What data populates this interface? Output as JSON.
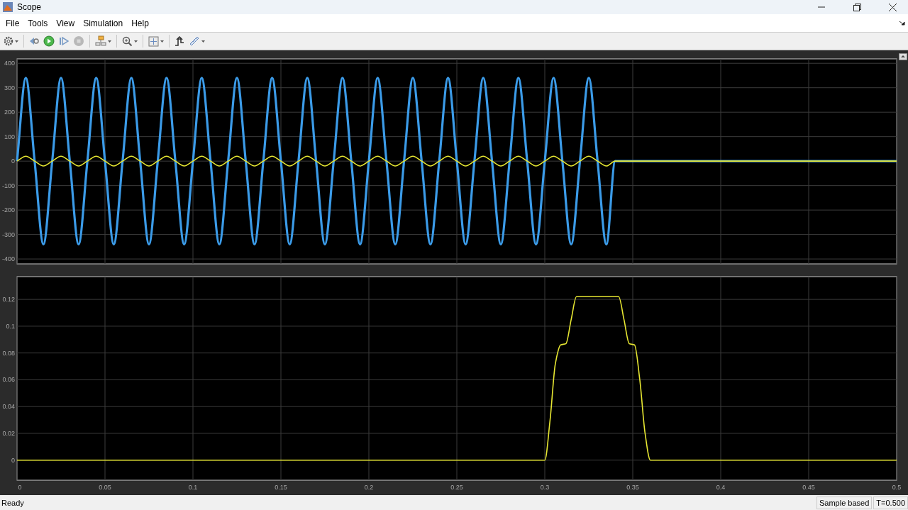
{
  "window": {
    "title": "Scope"
  },
  "menu": [
    "File",
    "Tools",
    "View",
    "Simulation",
    "Help"
  ],
  "charts": [
    {
      "chart_data": {
        "type": "line",
        "grid": true,
        "xlim": [
          0,
          0.5
        ],
        "ylim": [
          -420,
          418
        ],
        "yticks": [
          -400,
          -300,
          -200,
          -100,
          0,
          100,
          200,
          300,
          400
        ],
        "x": [
          0,
          0.005,
          0.01,
          0.015,
          0.02,
          0.025,
          0.03,
          0.035,
          0.04,
          0.045,
          0.05,
          0.055,
          0.06,
          0.065,
          0.07,
          0.075,
          0.08,
          0.085,
          0.09,
          0.095,
          0.1,
          0.105,
          0.11,
          0.115,
          0.12,
          0.125,
          0.13,
          0.135,
          0.14,
          0.145,
          0.15,
          0.155,
          0.16,
          0.165,
          0.17,
          0.175,
          0.18,
          0.185,
          0.19,
          0.195,
          0.2,
          0.205,
          0.21,
          0.215,
          0.22,
          0.225,
          0.23,
          0.235,
          0.24,
          0.245,
          0.25,
          0.255,
          0.26,
          0.265,
          0.27,
          0.275,
          0.28,
          0.285,
          0.29,
          0.295,
          0.3,
          0.305,
          0.31,
          0.315,
          0.32,
          0.325,
          0.33,
          0.335,
          0.34,
          0.345,
          0.35,
          0.355,
          0.36,
          0.365,
          0.37,
          0.375,
          0.38,
          0.385,
          0.39,
          0.395,
          0.4,
          0.405,
          0.41,
          0.415,
          0.42,
          0.425,
          0.43,
          0.435,
          0.44,
          0.445,
          0.45,
          0.455,
          0.46,
          0.465,
          0.47,
          0.475,
          0.48,
          0.485,
          0.49,
          0.495,
          0.5
        ],
        "series": [
          {
            "color": "#3b9be8",
            "values": [
              0,
              340,
              0,
              -340,
              0,
              340,
              0,
              -340,
              0,
              340,
              0,
              -340,
              0,
              340,
              0,
              -340,
              0,
              340,
              0,
              -340,
              0,
              340,
              0,
              -340,
              0,
              340,
              0,
              -340,
              0,
              340,
              0,
              -340,
              0,
              340,
              0,
              -340,
              0,
              340,
              0,
              -340,
              0,
              340,
              0,
              -340,
              0,
              340,
              0,
              -340,
              0,
              340,
              0,
              -340,
              0,
              340,
              0,
              -340,
              0,
              340,
              0,
              -340,
              0,
              340,
              0,
              -340,
              0,
              340,
              0,
              -340,
              0,
              0,
              0,
              0,
              0,
              0,
              0,
              0,
              0,
              0,
              0,
              0,
              0,
              0,
              0,
              0,
              0,
              0,
              0,
              0,
              0,
              0,
              0,
              0,
              0,
              0,
              0,
              0,
              0,
              0,
              0,
              0,
              0
            ]
          },
          {
            "color": "#e6e632",
            "values": [
              0,
              20,
              0,
              -20,
              0,
              20,
              0,
              -20,
              0,
              20,
              0,
              -20,
              0,
              20,
              0,
              -20,
              0,
              20,
              0,
              -20,
              0,
              20,
              0,
              -20,
              0,
              20,
              0,
              -20,
              0,
              20,
              0,
              -20,
              0,
              20,
              0,
              -20,
              0,
              20,
              0,
              -20,
              0,
              20,
              0,
              -20,
              0,
              20,
              0,
              -20,
              0,
              20,
              0,
              -20,
              0,
              20,
              0,
              -20,
              0,
              20,
              0,
              -20,
              0,
              20,
              0,
              -20,
              0,
              20,
              0,
              -20,
              0,
              0,
              0,
              0,
              0,
              0,
              0,
              0,
              0,
              0,
              0,
              0,
              0,
              0,
              0,
              0,
              0,
              0,
              0,
              0,
              0,
              0,
              0,
              0,
              0,
              0,
              0,
              0,
              0,
              0,
              0,
              0,
              0
            ]
          }
        ]
      }
    },
    {
      "chart_data": {
        "type": "line",
        "grid": true,
        "xlim": [
          0,
          0.5
        ],
        "ylim": [
          -0.015,
          0.137
        ],
        "xticks": [
          0,
          0.05,
          0.1,
          0.15,
          0.2,
          0.25,
          0.3,
          0.35,
          0.4,
          0.45,
          0.5
        ],
        "yticks": [
          0,
          0.02,
          0.04,
          0.06,
          0.08,
          0.1,
          0.12
        ],
        "x": [
          0,
          0.3,
          0.303,
          0.306,
          0.309,
          0.312,
          0.315,
          0.318,
          0.342,
          0.345,
          0.348,
          0.351,
          0.354,
          0.357,
          0.36,
          0.5
        ],
        "series": [
          {
            "color": "#e6e632",
            "values": [
              0,
              0,
              0.03,
              0.072,
              0.086,
              0.087,
              0.105,
              0.122,
              0.122,
              0.105,
              0.087,
              0.086,
              0.06,
              0.02,
              0,
              0
            ]
          }
        ]
      }
    }
  ],
  "status_bar": {
    "message": "Ready",
    "mode": "Sample based",
    "time": "T=0.500"
  }
}
